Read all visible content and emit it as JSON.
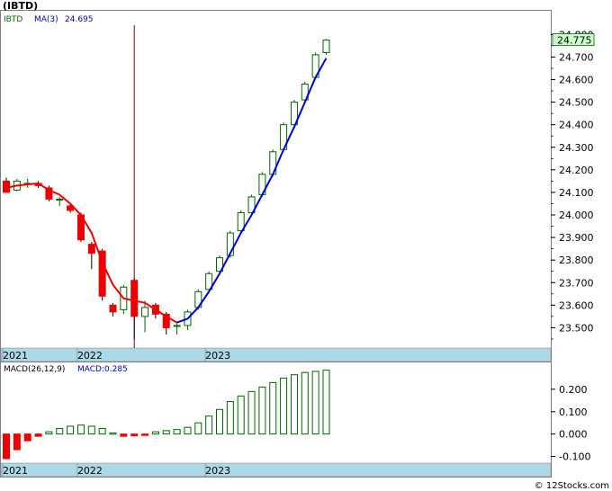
{
  "chart_data": {
    "type": "candlestick",
    "title": "(IBTD)",
    "main": {
      "ticker_label": "IBTD",
      "ma_label": "MA(3)",
      "ma_value": "24.695",
      "last_price": "24.775",
      "ylim": [
        23.41,
        24.905
      ],
      "y_ticks": [
        "23.500",
        "23.600",
        "23.700",
        "23.800",
        "23.900",
        "24.000",
        "24.100",
        "24.200",
        "24.300",
        "24.400",
        "24.500",
        "24.600",
        "24.700",
        "24.800"
      ],
      "x_labels": [
        {
          "label": "2021",
          "month": 0
        },
        {
          "label": "2022",
          "month": 7
        },
        {
          "label": "2023",
          "month": 19
        }
      ],
      "marker_month": 12,
      "candles": [
        {
          "o": 24.15,
          "h": 24.165,
          "l": 24.1,
          "c": 24.1
        },
        {
          "o": 24.11,
          "h": 24.16,
          "l": 24.105,
          "c": 24.15
        },
        {
          "o": 24.14,
          "h": 24.16,
          "l": 24.12,
          "c": 24.14
        },
        {
          "o": 24.14,
          "h": 24.15,
          "l": 24.12,
          "c": 24.13
        },
        {
          "o": 24.12,
          "h": 24.13,
          "l": 24.06,
          "c": 24.07
        },
        {
          "o": 24.07,
          "h": 24.08,
          "l": 24.04,
          "c": 24.07
        },
        {
          "o": 24.04,
          "h": 24.05,
          "l": 24.01,
          "c": 24.02
        },
        {
          "o": 24.0,
          "h": 24.01,
          "l": 23.88,
          "c": 23.89
        },
        {
          "o": 23.87,
          "h": 23.88,
          "l": 23.76,
          "c": 23.83
        },
        {
          "o": 23.84,
          "h": 23.85,
          "l": 23.62,
          "c": 23.64
        },
        {
          "o": 23.6,
          "h": 23.61,
          "l": 23.55,
          "c": 23.57
        },
        {
          "o": 23.58,
          "h": 23.69,
          "l": 23.56,
          "c": 23.68
        },
        {
          "o": 23.71,
          "h": 23.72,
          "l": 23.45,
          "c": 23.55
        },
        {
          "o": 23.55,
          "h": 23.62,
          "l": 23.48,
          "c": 23.59
        },
        {
          "o": 23.6,
          "h": 23.61,
          "l": 23.54,
          "c": 23.56
        },
        {
          "o": 23.56,
          "h": 23.57,
          "l": 23.47,
          "c": 23.5
        },
        {
          "o": 23.51,
          "h": 23.52,
          "l": 23.47,
          "c": 23.51
        },
        {
          "o": 23.51,
          "h": 23.58,
          "l": 23.49,
          "c": 23.57
        },
        {
          "o": 23.59,
          "h": 23.67,
          "l": 23.58,
          "c": 23.66
        },
        {
          "o": 23.67,
          "h": 23.75,
          "l": 23.66,
          "c": 23.74
        },
        {
          "o": 23.75,
          "h": 23.82,
          "l": 23.74,
          "c": 23.81
        },
        {
          "o": 23.82,
          "h": 23.93,
          "l": 23.81,
          "c": 23.92
        },
        {
          "o": 23.93,
          "h": 24.02,
          "l": 23.92,
          "c": 24.01
        },
        {
          "o": 24.01,
          "h": 24.09,
          "l": 24.0,
          "c": 24.08
        },
        {
          "o": 24.09,
          "h": 24.19,
          "l": 24.08,
          "c": 24.18
        },
        {
          "o": 24.18,
          "h": 24.29,
          "l": 24.17,
          "c": 24.28
        },
        {
          "o": 24.29,
          "h": 24.41,
          "l": 24.28,
          "c": 24.4
        },
        {
          "o": 24.4,
          "h": 24.51,
          "l": 24.39,
          "c": 24.5
        },
        {
          "o": 24.51,
          "h": 24.59,
          "l": 24.5,
          "c": 24.58
        },
        {
          "o": 24.61,
          "h": 24.72,
          "l": 24.6,
          "c": 24.71
        },
        {
          "o": 24.72,
          "h": 24.78,
          "l": 24.71,
          "c": 24.775
        }
      ],
      "ma_line": [
        {
          "m": 0,
          "v": 24.12
        },
        {
          "m": 1,
          "v": 24.13
        },
        {
          "m": 2,
          "v": 24.135
        },
        {
          "m": 3,
          "v": 24.14
        },
        {
          "m": 4,
          "v": 24.11
        },
        {
          "m": 5,
          "v": 24.09
        },
        {
          "m": 6,
          "v": 24.05
        },
        {
          "m": 7,
          "v": 24.0
        },
        {
          "m": 8,
          "v": 23.92
        },
        {
          "m": 9,
          "v": 23.79
        },
        {
          "m": 10,
          "v": 23.69
        },
        {
          "m": 11,
          "v": 23.63
        },
        {
          "m": 12,
          "v": 23.62
        },
        {
          "m": 13,
          "v": 23.61
        },
        {
          "m": 14,
          "v": 23.58
        },
        {
          "m": 15,
          "v": 23.55
        },
        {
          "m": 16,
          "v": 23.523
        },
        {
          "m": 17,
          "v": 23.54
        },
        {
          "m": 18,
          "v": 23.59
        },
        {
          "m": 19,
          "v": 23.66
        },
        {
          "m": 20,
          "v": 23.74
        },
        {
          "m": 21,
          "v": 23.83
        },
        {
          "m": 22,
          "v": 23.92
        },
        {
          "m": 23,
          "v": 24.0
        },
        {
          "m": 24,
          "v": 24.09
        },
        {
          "m": 25,
          "v": 24.18
        },
        {
          "m": 26,
          "v": 24.29
        },
        {
          "m": 27,
          "v": 24.39
        },
        {
          "m": 28,
          "v": 24.5
        },
        {
          "m": 29,
          "v": 24.61
        },
        {
          "m": 30,
          "v": 24.695
        }
      ],
      "ma_down_color": "#ee0000",
      "ma_up_color": "#0000cc",
      "ma_turn_month": 16
    },
    "macd": {
      "label": "MACD(26,12,9)",
      "value_label": "MACD:0.285",
      "ylim": [
        -0.13,
        0.32
      ],
      "y_ticks": [
        "-0.100",
        "0.000",
        "0.100",
        "0.200"
      ],
      "x_labels": [
        {
          "label": "2021",
          "month": 0
        },
        {
          "label": "2022",
          "month": 7
        },
        {
          "label": "2023",
          "month": 19
        }
      ],
      "values": [
        -0.11,
        -0.07,
        -0.03,
        -0.01,
        0.01,
        0.025,
        0.035,
        0.04,
        0.035,
        0.025,
        0.005,
        -0.01,
        -0.008,
        -0.005,
        0.01,
        0.015,
        0.02,
        0.03,
        0.05,
        0.08,
        0.11,
        0.145,
        0.17,
        0.19,
        0.21,
        0.23,
        0.25,
        0.265,
        0.275,
        0.28,
        0.285
      ]
    },
    "colors": {
      "up": "#006600",
      "down": "#ee0000",
      "axis_band": "#add8e6",
      "marker": "#800000",
      "price_box": "#ccffcc"
    }
  },
  "watermark": "© 12Stocks.com"
}
